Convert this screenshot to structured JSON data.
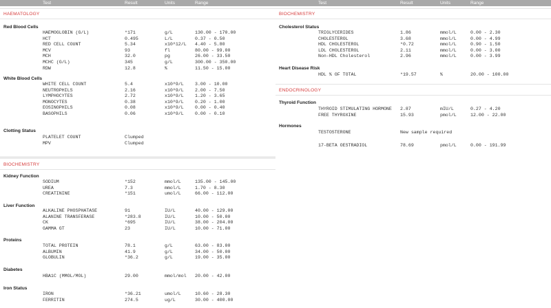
{
  "header": {
    "test": "Test",
    "result": "Result",
    "units": "Units",
    "range": "Range"
  },
  "left": {
    "haematology": {
      "title": "HAEMATOLOGY",
      "red": {
        "label": "Red Blood Cells",
        "rows": [
          {
            "test": "HAEMOGLOBIN (G/L)",
            "result": "*171",
            "units": "g/L",
            "range": "130.00 - 170.00"
          },
          {
            "test": "HCT",
            "result": "0.495",
            "units": "L/L",
            "range": "0.37 - 0.50"
          },
          {
            "test": "RED CELL COUNT",
            "result": "5.34",
            "units": "x10^12/L",
            "range": "4.40 - 5.80"
          },
          {
            "test": "MCV",
            "result": "93",
            "units": "fl",
            "range": "80.00 - 99.00"
          },
          {
            "test": "MCH",
            "result": "32.0",
            "units": "pg",
            "range": "26.00 - 33.50"
          },
          {
            "test": "MCHC (G/L)",
            "result": "345",
            "units": "g/L",
            "range": "300.00 - 350.00"
          },
          {
            "test": "RDW",
            "result": "12.8",
            "units": "%",
            "range": "11.50 - 15.00"
          }
        ]
      },
      "white": {
        "label": "White Blood Cells",
        "rows": [
          {
            "test": "WHITE CELL COUNT",
            "result": "5.4",
            "units": "x10^9/L",
            "range": "3.00 - 10.00"
          },
          {
            "test": "NEUTROPHILS",
            "result": "2.16",
            "units": "x10^9/L",
            "range": "2.00 - 7.50"
          },
          {
            "test": "LYMPHOCYTES",
            "result": "2.72",
            "units": "x10^9/L",
            "range": "1.20 - 3.65"
          },
          {
            "test": "MONOCYTES",
            "result": "0.38",
            "units": "x10^9/L",
            "range": "0.20 - 1.00"
          },
          {
            "test": "EOSINOPHILS",
            "result": "0.08",
            "units": "x10^9/L",
            "range": "0.00 - 0.40"
          },
          {
            "test": "BASOPHILS",
            "result": "0.06",
            "units": "x10^9/L",
            "range": "0.00 - 0.10"
          }
        ]
      },
      "clotting": {
        "label": "Clotting Status",
        "rows": [
          {
            "test": "PLATELET COUNT",
            "result": "Clumped",
            "units": "",
            "range": ""
          },
          {
            "test": "MPV",
            "result": "Clumped",
            "units": "",
            "range": ""
          }
        ]
      }
    },
    "biochemistry": {
      "title": "BIOCHEMISTRY",
      "kidney": {
        "label": "Kidney Function",
        "rows": [
          {
            "test": "SODIUM",
            "result": "*152",
            "units": "mmol/L",
            "range": "135.00 - 145.00"
          },
          {
            "test": "UREA",
            "result": "7.3",
            "units": "mmol/L",
            "range": "1.70 - 8.30"
          },
          {
            "test": "CREATININE",
            "result": "*151",
            "units": "umol/L",
            "range": "66.00 - 112.00"
          }
        ]
      },
      "liver": {
        "label": "Liver Function",
        "rows": [
          {
            "test": "ALKALINE PHOSPHATASE",
            "result": "91",
            "units": "IU/L",
            "range": "40.00 - 129.00"
          },
          {
            "test": "ALANINE TRANSFERASE",
            "result": "*283.8",
            "units": "IU/L",
            "range": "10.00 - 50.00"
          },
          {
            "test": "CK",
            "result": "*695",
            "units": "IU/L",
            "range": "38.00 - 204.00"
          },
          {
            "test": "GAMMA GT",
            "result": "23",
            "units": "IU/L",
            "range": "10.00 - 71.00"
          }
        ]
      },
      "proteins": {
        "label": "Proteins",
        "rows": [
          {
            "test": "TOTAL PROTEIN",
            "result": "78.1",
            "units": "g/L",
            "range": "63.00 - 83.00"
          },
          {
            "test": "ALBUMIN",
            "result": "41.9",
            "units": "g/L",
            "range": "34.00 - 50.00"
          },
          {
            "test": "GLOBULIN",
            "result": "*36.2",
            "units": "g/L",
            "range": "19.00 - 35.00"
          }
        ]
      },
      "diabetes": {
        "label": "Diabetes",
        "rows": [
          {
            "test": "HBA1C (MMOL/MOL)",
            "result": "29.00",
            "units": "mmol/mol",
            "range": "20.00 - 42.00"
          }
        ]
      },
      "iron": {
        "label": "Iron Status",
        "rows": [
          {
            "test": "IRON",
            "result": "*36.21",
            "units": "umol/L",
            "range": "10.60 - 28.30"
          },
          {
            "test": "FERRITIN",
            "result": "274.5",
            "units": "ug/L",
            "range": "30.00 - 400.00"
          }
        ]
      }
    }
  },
  "right": {
    "biochemistry": {
      "title": "BIOCHEMISTRY",
      "cholesterol": {
        "label": "Cholesterol Status",
        "rows": [
          {
            "test": "TRIGLYCERIDES",
            "result": "1.86",
            "units": "mmol/L",
            "range": "0.00 - 2.30"
          },
          {
            "test": "CHOLESTEROL",
            "result": "3.68",
            "units": "mmol/L",
            "range": "0.00 - 4.99"
          },
          {
            "test": "HDL CHOLESTEROL",
            "result": "*0.72",
            "units": "mmol/L",
            "range": "0.90 - 1.50"
          },
          {
            "test": "LDL CHOLESTEROL",
            "result": "2.11",
            "units": "mmol/L",
            "range": "0.00 - 3.00"
          },
          {
            "test": "Non-HDL Cholesterol",
            "result": "2.96",
            "units": "mmol/L",
            "range": "0.00 - 3.99"
          }
        ]
      },
      "heart": {
        "label": "Heart Disease Risk",
        "rows": [
          {
            "test": "HDL % OF TOTAL",
            "result": "*19.57",
            "units": "%",
            "range": "20.00 - 100.00"
          }
        ]
      }
    },
    "endocrinology": {
      "title": "ENDOCRINOLOGY",
      "thyroid": {
        "label": "Thyroid Function",
        "rows": [
          {
            "test": "THYROID STIMULATING HORMONE",
            "result": "2.87",
            "units": "mIU/L",
            "range": "0.27 - 4.20"
          },
          {
            "test": "FREE THYROXINE",
            "result": "15.93",
            "units": "pmol/L",
            "range": "12.00 - 22.00"
          }
        ]
      },
      "hormones": {
        "label": "Hormones",
        "rows": [
          {
            "test": "TESTOSTERONE",
            "result": "New sample required",
            "units": "",
            "range": ""
          },
          {
            "test": "17-BETA OESTRADIOL",
            "result": "78.69",
            "units": "pmol/L",
            "range": "0.00 - 191.99"
          }
        ]
      }
    }
  }
}
